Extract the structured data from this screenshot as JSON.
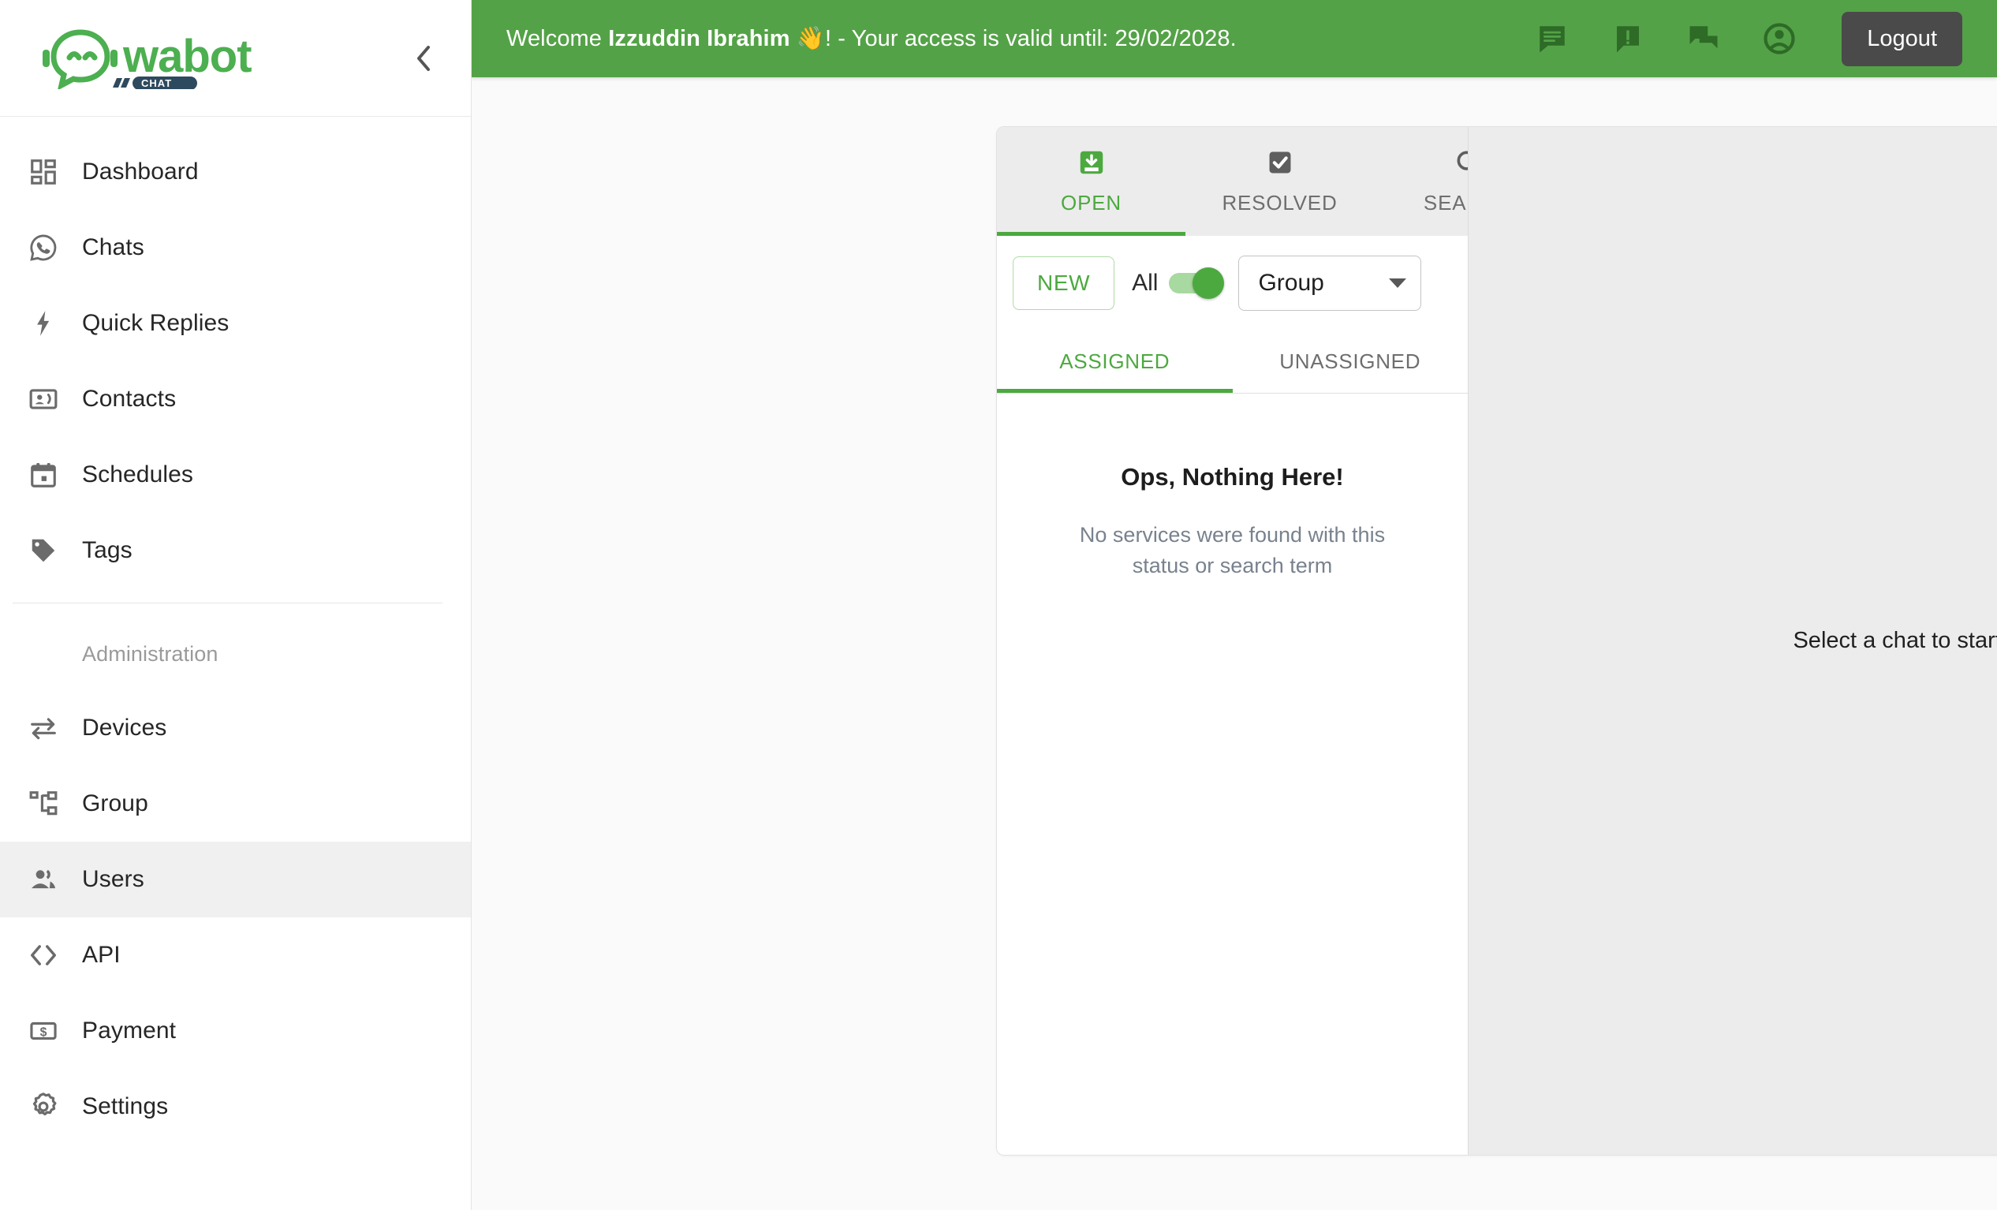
{
  "brand": {
    "name": "wabot",
    "sub": "CHAT",
    "color": "#4CAF50",
    "sub_badge_color": "#2e4a5e"
  },
  "sidebar": {
    "collapse_icon": "chevron-left-icon",
    "items": [
      {
        "label": "Dashboard",
        "icon": "dashboard-grid-icon",
        "active": false,
        "type": "item"
      },
      {
        "label": "Chats",
        "icon": "whatsapp-icon",
        "active": false,
        "type": "item"
      },
      {
        "label": "Quick Replies",
        "icon": "bolt-icon",
        "active": false,
        "type": "item"
      },
      {
        "label": "Contacts",
        "icon": "contact-card-icon",
        "active": false,
        "type": "item"
      },
      {
        "label": "Schedules",
        "icon": "calendar-icon",
        "active": false,
        "type": "item"
      },
      {
        "label": "Tags",
        "icon": "tag-icon",
        "active": false,
        "type": "item"
      },
      {
        "label": "Administration",
        "icon": "",
        "active": false,
        "type": "section"
      },
      {
        "label": "Devices",
        "icon": "swap-arrows-icon",
        "active": false,
        "type": "item"
      },
      {
        "label": "Group",
        "icon": "sitemap-icon",
        "active": false,
        "type": "item"
      },
      {
        "label": "Users",
        "icon": "people-icon",
        "active": true,
        "type": "item"
      },
      {
        "label": "API",
        "icon": "code-brackets-icon",
        "active": false,
        "type": "item"
      },
      {
        "label": "Payment",
        "icon": "money-card-icon",
        "active": false,
        "type": "item"
      },
      {
        "label": "Settings",
        "icon": "gear-icon",
        "active": false,
        "type": "item"
      }
    ]
  },
  "topbar": {
    "background": "#54A247",
    "welcome_prefix": "Welcome ",
    "user_name": "Izzuddin Ibrahim",
    "wave_emoji": "👋",
    "welcome_suffix": "! - Your access is valid until: 29/02/2028.",
    "icons": [
      {
        "name": "notes-message-icon"
      },
      {
        "name": "alert-message-icon"
      },
      {
        "name": "chat-reply-icon"
      },
      {
        "name": "account-circle-icon"
      }
    ],
    "logout_label": "Logout"
  },
  "chat_panel": {
    "status_tabs": [
      {
        "label": "OPEN",
        "icon": "inbox-download-icon",
        "active": true
      },
      {
        "label": "RESOLVED",
        "icon": "checkbox-checked-icon",
        "active": false
      },
      {
        "label": "SEARCH",
        "icon": "search-icon",
        "active": false
      }
    ],
    "filters": {
      "new_label": "NEW",
      "toggle_label": "All",
      "toggle_on": true,
      "select_value": "Group",
      "select_caret": "chevron-down-icon"
    },
    "assign_tabs": [
      {
        "label": "ASSIGNED",
        "active": true
      },
      {
        "label": "UNASSIGNED",
        "active": false
      }
    ],
    "empty_state": {
      "title": "Ops, Nothing Here!",
      "message": "No services were found with this status or search term"
    }
  },
  "chat_view": {
    "placeholder": "Select a chat to start chatting."
  }
}
